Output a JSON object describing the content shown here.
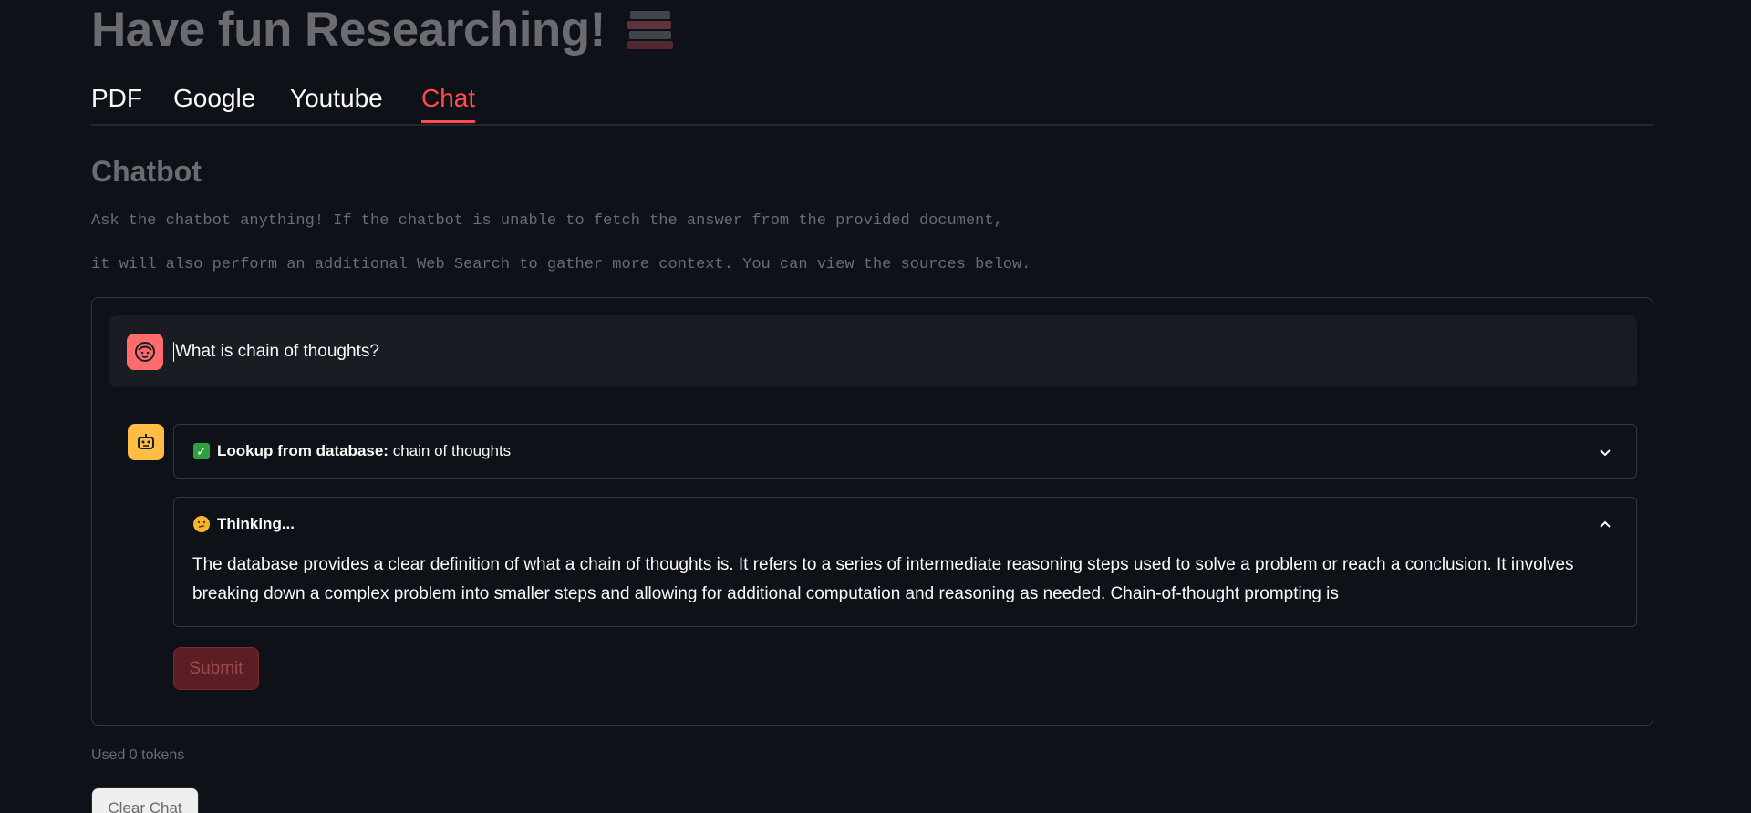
{
  "header": {
    "title": "Have fun Researching!",
    "title_icon": "books-icon"
  },
  "tabs": [
    {
      "label": "PDF",
      "active": false
    },
    {
      "label": "Google",
      "active": false
    },
    {
      "label": "Youtube",
      "active": false
    },
    {
      "label": "Chat",
      "active": true
    }
  ],
  "section": {
    "title": "Chatbot",
    "description_line1": "Ask the chatbot anything! If the chatbot is unable to fetch the answer from the provided document,",
    "description_line2": "it will also perform an additional Web Search to gather more context. You can view the sources below."
  },
  "chat": {
    "user_message": "What is chain of thoughts?",
    "lookup": {
      "label": "Lookup from database:",
      "value": "chain of thoughts",
      "icon": "check-mark-icon",
      "expanded": false
    },
    "thinking": {
      "label": "Thinking...",
      "icon": "thinking-face-icon",
      "expanded": true,
      "body": "The database provides a clear definition of what a chain of thoughts is. It refers to a series of intermediate reasoning steps used to solve a problem or reach a conclusion. It involves breaking down a complex problem into smaller steps and allowing for additional computation and reasoning as needed. Chain-of-thought prompting is"
    },
    "submit_label": "Submit"
  },
  "footer": {
    "tokens": "Used 0 tokens",
    "clear_label": "Clear Chat"
  },
  "colors": {
    "background": "#0e1117",
    "accent": "#ff4b4b",
    "user_avatar": "#ff6c6c",
    "bot_avatar": "#ffbd45"
  }
}
